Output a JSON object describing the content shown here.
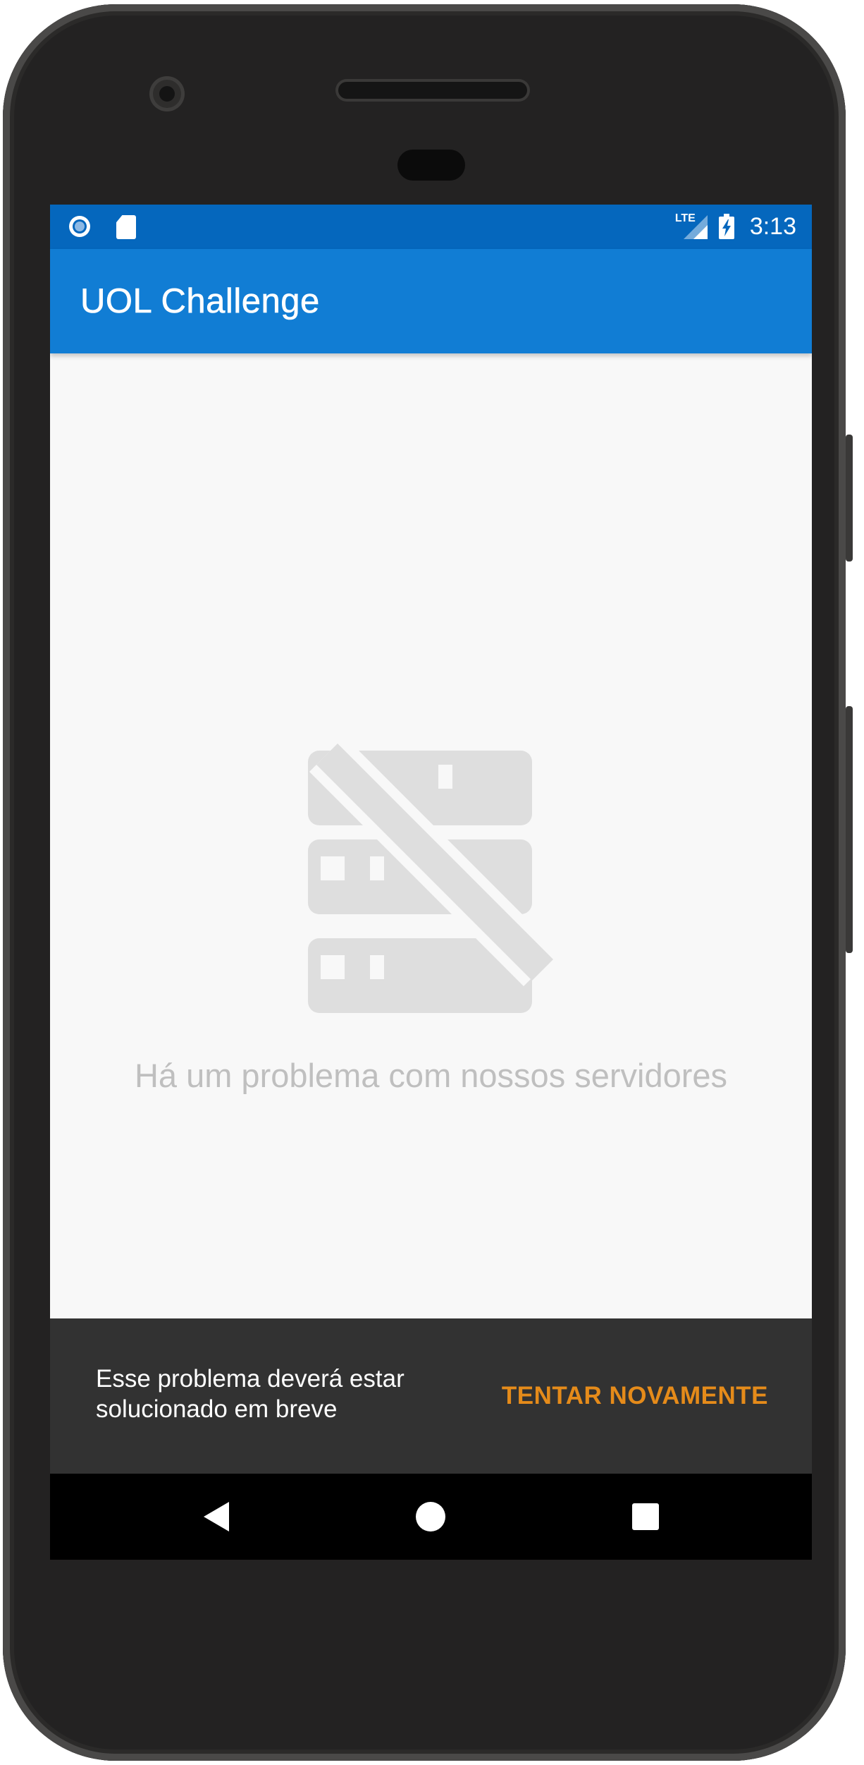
{
  "statusbar": {
    "icons_left": [
      "radio-button-icon",
      "sd-card-icon"
    ],
    "network": "LTE",
    "time": "3:13"
  },
  "appbar": {
    "title": "UOL Challenge"
  },
  "empty_state": {
    "icon": "server-off-icon",
    "message": "Há um problema com nossos servidores"
  },
  "snackbar": {
    "message": "Esse problema deverá estar solucionado em breve",
    "action_label": "TENTAR NOVAMENTE"
  },
  "navbar": {
    "buttons": [
      "back-icon",
      "home-icon",
      "recents-icon"
    ]
  },
  "colors": {
    "statusbar": "#0567bd",
    "appbar": "#117dd4",
    "background": "#f8f8f8",
    "snackbar": "#323232",
    "snackbar_action": "#e58b1a",
    "empty_text": "#bfbfbf"
  }
}
